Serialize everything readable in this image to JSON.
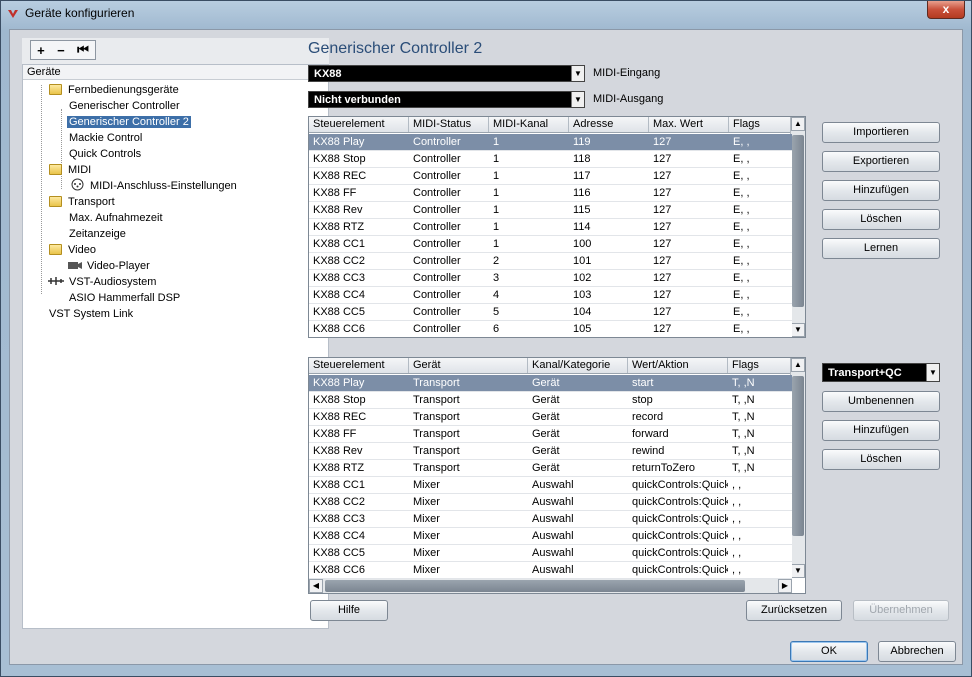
{
  "window": {
    "title": "Geräte konfigurieren",
    "close": "x"
  },
  "tree": {
    "toolbar": {
      "add": "+",
      "remove": "−",
      "reset": "⏮"
    },
    "header": "Geräte",
    "nodes": [
      {
        "label": "Fernbedienungsgeräte",
        "icon": "folder-icon"
      },
      {
        "label": "Generischer Controller"
      },
      {
        "label": "Generischer Controller 2"
      },
      {
        "label": "Mackie Control"
      },
      {
        "label": "Quick Controls"
      },
      {
        "label": "MIDI",
        "icon": "folder-icon"
      },
      {
        "label": "MIDI-Anschluss-Einstellungen",
        "icon": "midi-port-icon"
      },
      {
        "label": "Transport",
        "icon": "folder-icon"
      },
      {
        "label": "Max. Aufnahmezeit"
      },
      {
        "label": "Zeitanzeige"
      },
      {
        "label": "Video",
        "icon": "folder-icon"
      },
      {
        "label": "Video-Player",
        "icon": "video-icon"
      },
      {
        "label": "VST-Audiosystem",
        "icon": "audio-system-icon"
      },
      {
        "label": "ASIO Hammerfall DSP"
      },
      {
        "label": "VST System Link"
      }
    ]
  },
  "main": {
    "heading": "Generischer Controller 2",
    "midi_in": {
      "value": "KX88",
      "label": "MIDI-Eingang"
    },
    "midi_out": {
      "value": "Nicht verbunden",
      "label": "MIDI-Ausgang"
    },
    "table1": {
      "columns": [
        "Steuerelement",
        "MIDI-Status",
        "MIDI-Kanal",
        "Adresse",
        "Max. Wert",
        "Flags"
      ],
      "rows": [
        [
          "KX88 Play",
          "Controller",
          "1",
          "119",
          "127",
          "E, ,"
        ],
        [
          "KX88 Stop",
          "Controller",
          "1",
          "118",
          "127",
          "E, ,"
        ],
        [
          "KX88 REC",
          "Controller",
          "1",
          "117",
          "127",
          "E, ,"
        ],
        [
          "KX88 FF",
          "Controller",
          "1",
          "116",
          "127",
          "E, ,"
        ],
        [
          "KX88 Rev",
          "Controller",
          "1",
          "115",
          "127",
          "E, ,"
        ],
        [
          "KX88 RTZ",
          "Controller",
          "1",
          "114",
          "127",
          "E, ,"
        ],
        [
          "KX88 CC1",
          "Controller",
          "1",
          "100",
          "127",
          "E, ,"
        ],
        [
          "KX88 CC2",
          "Controller",
          "2",
          "101",
          "127",
          "E, ,"
        ],
        [
          "KX88 CC3",
          "Controller",
          "3",
          "102",
          "127",
          "E, ,"
        ],
        [
          "KX88 CC4",
          "Controller",
          "4",
          "103",
          "127",
          "E, ,"
        ],
        [
          "KX88 CC5",
          "Controller",
          "5",
          "104",
          "127",
          "E, ,"
        ],
        [
          "KX88 CC6",
          "Controller",
          "6",
          "105",
          "127",
          "E, ,"
        ]
      ]
    },
    "table2": {
      "columns": [
        "Steuerelement",
        "Gerät",
        "Kanal/Kategorie",
        "Wert/Aktion",
        "Flags"
      ],
      "rows": [
        [
          "KX88 Play",
          "Transport",
          "Gerät",
          "start",
          "T, ,N"
        ],
        [
          "KX88 Stop",
          "Transport",
          "Gerät",
          "stop",
          "T, ,N"
        ],
        [
          "KX88 REC",
          "Transport",
          "Gerät",
          "record",
          "T, ,N"
        ],
        [
          "KX88 FF",
          "Transport",
          "Gerät",
          "forward",
          "T, ,N"
        ],
        [
          "KX88 Rev",
          "Transport",
          "Gerät",
          "rewind",
          "T, ,N"
        ],
        [
          "KX88 RTZ",
          "Transport",
          "Gerät",
          "returnToZero",
          "T, ,N"
        ],
        [
          "KX88 CC1",
          "Mixer",
          "Auswahl",
          "quickControls:QuickC",
          ", ,"
        ],
        [
          "KX88 CC2",
          "Mixer",
          "Auswahl",
          "quickControls:QuickC",
          ", ,"
        ],
        [
          "KX88 CC3",
          "Mixer",
          "Auswahl",
          "quickControls:QuickC",
          ", ,"
        ],
        [
          "KX88 CC4",
          "Mixer",
          "Auswahl",
          "quickControls:QuickC",
          ", ,"
        ],
        [
          "KX88 CC5",
          "Mixer",
          "Auswahl",
          "quickControls:QuickC",
          ", ,"
        ],
        [
          "KX88 CC6",
          "Mixer",
          "Auswahl",
          "quickControls:QuickC",
          ", ,"
        ]
      ]
    },
    "side_buttons_1": [
      "Importieren",
      "Exportieren",
      "Hinzufügen",
      "Löschen",
      "Lernen"
    ],
    "bank_select": "Transport+QC",
    "side_buttons_2": [
      "Umbenennen",
      "Hinzufügen",
      "Löschen"
    ],
    "help": "Hilfe",
    "reset": "Zurücksetzen",
    "apply": "Übernehmen"
  },
  "footer": {
    "ok": "OK",
    "cancel": "Abbrechen"
  }
}
